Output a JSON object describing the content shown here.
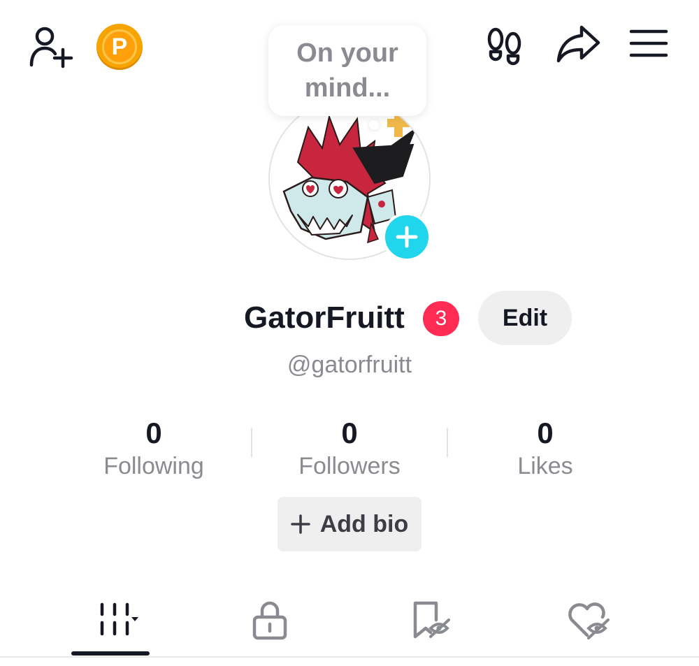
{
  "header": {
    "coin_letter": "P",
    "status_prompt": "On your mind..."
  },
  "profile": {
    "display_name": "GatorFruitt",
    "notification_count": "3",
    "edit_label": "Edit",
    "handle": "@gatorfruitt"
  },
  "stats": [
    {
      "value": "0",
      "label": "Following"
    },
    {
      "value": "0",
      "label": "Followers"
    },
    {
      "value": "0",
      "label": "Likes"
    }
  ],
  "bio": {
    "add_label": "Add bio"
  },
  "tabs": [
    {
      "icon": "grid-icon"
    },
    {
      "icon": "lock-icon"
    },
    {
      "icon": "bookmark-hidden-icon"
    },
    {
      "icon": "liked-hidden-icon"
    }
  ],
  "colors": {
    "accent_red": "#fe2c55",
    "add_blue": "#20d5ec",
    "coin_orange": "#f7a400",
    "muted_text": "#8a8b91"
  }
}
